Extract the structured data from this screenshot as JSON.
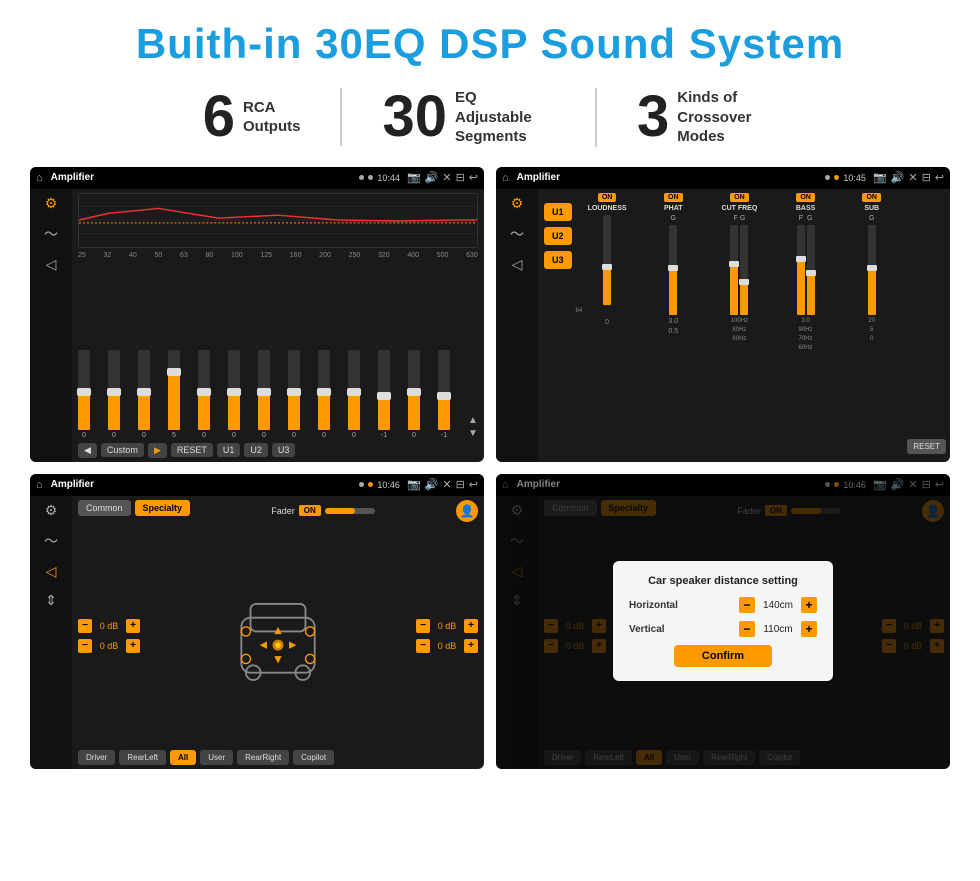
{
  "title": "Buith-in 30EQ DSP Sound System",
  "stats": [
    {
      "number": "6",
      "label": "RCA\nOutputs"
    },
    {
      "number": "30",
      "label": "EQ Adjustable\nSegments"
    },
    {
      "number": "3",
      "label": "Kinds of\nCrossover Modes"
    }
  ],
  "screens": {
    "eq": {
      "title": "Amplifier",
      "time": "10:44",
      "frequencies": [
        "25",
        "32",
        "40",
        "50",
        "63",
        "80",
        "100",
        "125",
        "160",
        "200",
        "250",
        "320",
        "400",
        "500",
        "630"
      ],
      "sliders": [
        0,
        0,
        0,
        5,
        0,
        0,
        0,
        0,
        0,
        0,
        0,
        -1,
        0,
        -1
      ],
      "buttons": [
        "◀",
        "Custom",
        "▶",
        "RESET",
        "U1",
        "U2",
        "U3"
      ]
    },
    "crossover": {
      "title": "Amplifier",
      "time": "10:45",
      "u_buttons": [
        "U1",
        "U2",
        "U3"
      ],
      "channels": [
        {
          "label": "LOUDNESS",
          "on": true
        },
        {
          "label": "PHAT",
          "on": true
        },
        {
          "label": "CUT FREQ",
          "on": true
        },
        {
          "label": "BASS",
          "on": true
        },
        {
          "label": "SUB",
          "on": true
        }
      ],
      "reset": "RESET"
    },
    "fader": {
      "title": "Amplifier",
      "time": "10:46",
      "tabs": [
        "Common",
        "Specialty"
      ],
      "fader_label": "Fader",
      "on": "ON",
      "values": [
        {
          "label": "0 dB"
        },
        {
          "label": "0 dB"
        },
        {
          "label": "0 dB"
        },
        {
          "label": "0 dB"
        }
      ],
      "bottom_buttons": [
        "Driver",
        "RearLeft",
        "All",
        "User",
        "RearRight",
        "Copilot"
      ]
    },
    "dialog": {
      "title": "Amplifier",
      "time": "10:46",
      "dialog_title": "Car speaker distance setting",
      "horizontal_label": "Horizontal",
      "horizontal_value": "140cm",
      "vertical_label": "Vertical",
      "vertical_value": "110cm",
      "confirm_label": "Confirm",
      "bottom_buttons": [
        "Driver",
        "RearLeft",
        "All",
        "User",
        "RearRight",
        "Copilot"
      ]
    }
  },
  "icons": {
    "home": "⌂",
    "eq_icon": "♦",
    "wave_icon": "〜",
    "volume_icon": "◁",
    "settings_icon": "⚙",
    "location": "📍",
    "camera": "📷",
    "speaker": "🔊",
    "close": "✕",
    "window": "⊟",
    "back": "↩",
    "record": "⬤",
    "play": "▶",
    "next": "⏭"
  }
}
